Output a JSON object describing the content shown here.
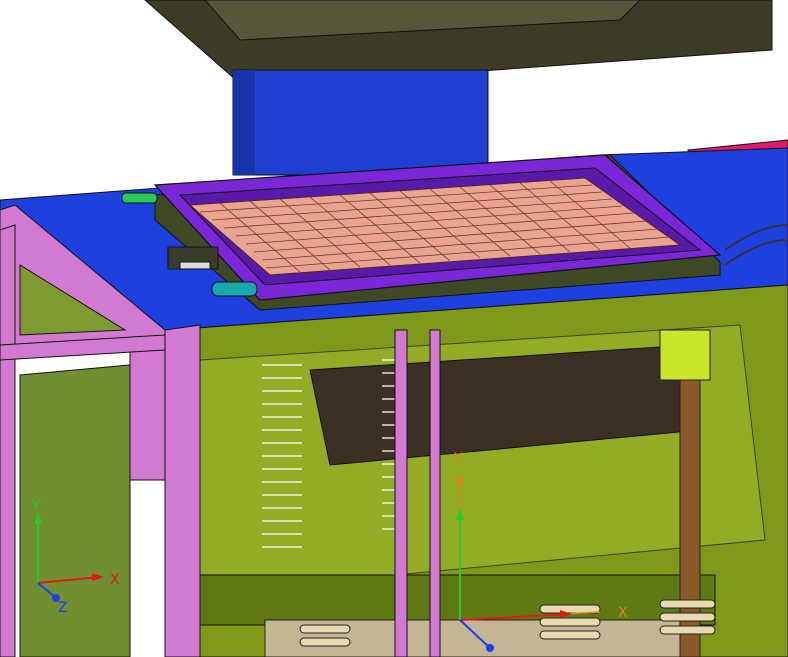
{
  "viewport": {
    "background": "#ffffff",
    "colors": {
      "press_head": "#3d3a25",
      "press_column": "#1f3fd0",
      "table_top": "#1f40e0",
      "frame": "#d27ad2",
      "tray_frame": "#7b26d8",
      "grid_cells": "#e9a38f",
      "enclosure": "#7f9a1a",
      "dark_panel": "#3c3025",
      "accent_pink": "#e0186e"
    }
  },
  "triad": {
    "x_label": "X",
    "y_label": "Y",
    "z_label": "Z",
    "x_color": "#e01a1a",
    "y_color": "#2cc72c",
    "z_color": "#1e3cff"
  },
  "origin_axes": {
    "x_label": "X",
    "y_label": "Y",
    "color": "#e3821e"
  }
}
